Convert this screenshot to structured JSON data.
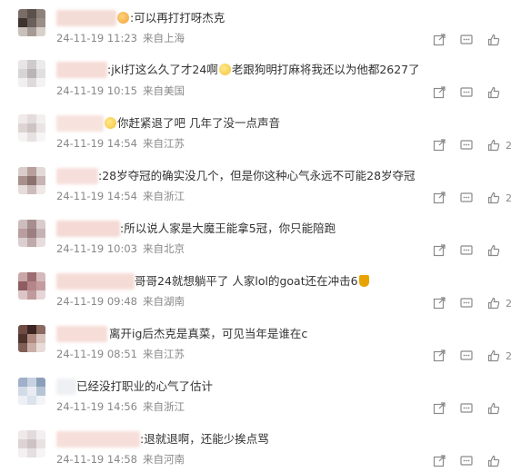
{
  "comments": [
    {
      "text": ":可以再打打呀杰克",
      "emoji_before": true,
      "emoji_after": false,
      "time": "24-11-19 11:23",
      "source": "来自上海",
      "likes": ""
    },
    {
      "text": ":jkl打这么久了才24啊",
      "text2": "老跟狗明打麻将我还以为他都2627了",
      "emoji_mid": true,
      "time": "24-11-19 10:15",
      "source": "来自美国",
      "likes": ""
    },
    {
      "text": "你赶紧退了吧 几年了没一点声音",
      "emoji_before": true,
      "time": "24-11-19 14:54",
      "source": "来自江苏",
      "likes": "2"
    },
    {
      "text": ":28岁夺冠的确实没几个，但是你这种心气永远不可能28岁夺冠",
      "time": "24-11-19 14:54",
      "source": "来自浙江",
      "likes": "2"
    },
    {
      "text": ":所以说人家是大魔王能拿5冠，你只能陪跑",
      "time": "24-11-19 10:03",
      "source": "来自北京",
      "likes": ""
    },
    {
      "text": "哥哥24就想躺平了  人家lol的goat还在冲击6",
      "trophy": true,
      "time": "24-11-19 09:48",
      "source": "来自湖南",
      "likes": "2"
    },
    {
      "text": "离开ig后杰克是真菜，可见当年是谁在c",
      "time": "24-11-19 08:51",
      "source": "来自江苏",
      "likes": "2"
    },
    {
      "text": "已经没打职业的心气了估计",
      "time": "24-11-19 14:56",
      "source": "来自浙江",
      "likes": ""
    },
    {
      "text": ":退就退啊，还能少挨点骂",
      "time": "24-11-19 14:58",
      "source": "来自河南",
      "likes": ""
    }
  ],
  "icons": {
    "share": "share-icon",
    "comment": "comment-icon",
    "like": "thumbs-up-icon"
  },
  "colors": {
    "meta": "#888888",
    "text": "#333333",
    "icon": "#8a8a8a"
  }
}
